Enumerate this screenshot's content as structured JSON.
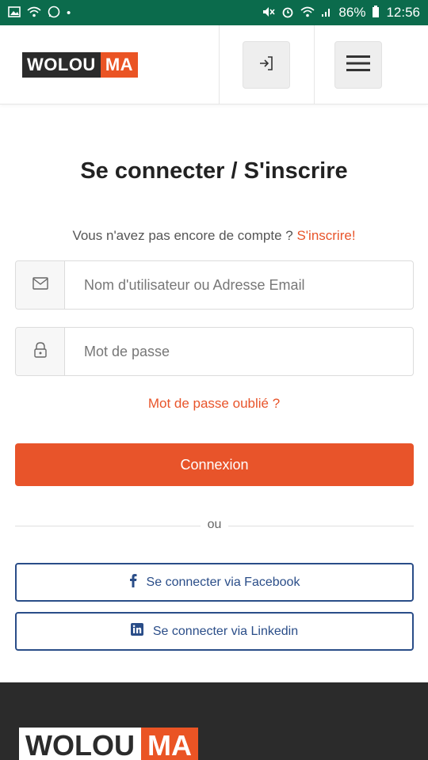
{
  "status_bar": {
    "battery": "86%",
    "time": "12:56",
    "left_icons": [
      "image-icon",
      "wifi-icon",
      "whatsapp-icon",
      "dot-icon"
    ],
    "right_icons": [
      "mute-icon",
      "alarm-icon",
      "wifi-icon",
      "signal-icon",
      "battery-icon"
    ]
  },
  "header": {
    "logo_left": "WOLOU",
    "logo_right": "MA",
    "login_icon": "login-icon",
    "menu_icon": "hamburger-icon"
  },
  "main": {
    "title": "Se connecter / S'inscrire",
    "signup_prompt": "Vous n'avez pas encore de compte ?",
    "signup_link": "S'inscrire!",
    "username_placeholder": "Nom d'utilisateur ou Adresse Email",
    "password_placeholder": "Mot de passe",
    "forgot_password": "Mot de passe oublié ?",
    "login_button": "Connexion",
    "divider_text": "ou",
    "facebook_button": "Se connecter via Facebook",
    "linkedin_button": "Se connecter via Linkedin"
  },
  "footer": {
    "logo_left": "WOLOU",
    "logo_right": "MA"
  },
  "colors": {
    "accent": "#e8542a",
    "status_bar": "#0b6b4c",
    "social_border": "#2a4d88",
    "footer_bg": "#2b2b2b"
  }
}
